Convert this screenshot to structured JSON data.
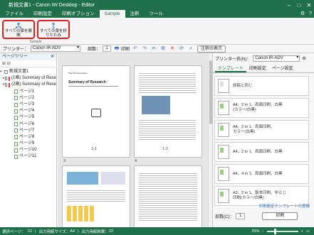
{
  "window": {
    "title": "新規文書1 - Canon iW Desktop - Editor"
  },
  "menu": {
    "items": [
      "ファイル",
      "印刷設定",
      "印刷オプション",
      "Sample",
      "注釈",
      "ツール"
    ],
    "active_index": 3
  },
  "ribbon": {
    "expand_all_label": "すべての章を展開",
    "collapse_all_label": "すべての章を折りたたみ",
    "group_label": "Sample"
  },
  "toolbar": {
    "printer_label": "プリンター：",
    "printer_value": "Canon iR-ADV",
    "copies_label": "部数：",
    "copies_value": "1",
    "print_label": "印刷",
    "annotation_btn": "注釈の表示"
  },
  "page_tree": {
    "header": "ページツリー",
    "root": "新規文書1",
    "chapters": [
      "(1章) Summary of Rese",
      "(2章) Summary of Rese"
    ],
    "pages": [
      "ページ1",
      "ページ2",
      "ページ3",
      "ページ4",
      "ページ5",
      "ページ6",
      "ページ7",
      "ページ8",
      "ページ9",
      "ページ10",
      "ページ11"
    ]
  },
  "thumbnails": {
    "labels": [
      "1-1",
      "1-2",
      "3",
      "4"
    ],
    "p1_title": "Summary of Research",
    "p1_company": "The XX Corporation"
  },
  "right_panel": {
    "printer_label": "プリンター名(N)：",
    "printer_value": "Canon iR-ADV",
    "tabs": [
      "テンプレート",
      "印刷設定",
      "ページ設定"
    ],
    "templates": [
      "原稿と同じ",
      "A4、2 in 1、両面印刷、白黒\n(カラー/白黒)",
      "A4、2 in 1、両面印刷、\nカラー(白黒)",
      "A4、2 in 1、両面印刷、白黒",
      "A4、4 in 1、両面印刷、白黒",
      "A3、2 in 1、製本印刷、中とじ\n印刷(カラー/白黒)"
    ],
    "save_template_link": "印刷設定テンプレートの登録",
    "copies_label": "部数(C)：",
    "copies_value": "1",
    "print_button": "印刷"
  },
  "status": {
    "selected": "選択ページ：",
    "selected_value": "22",
    "output_size_label": "出力用紙サイズ：",
    "output_size": "A4",
    "page_count_label": "出力用紙枚数：",
    "page_count": "22",
    "zoom": "25%"
  },
  "colors": {
    "accent": "#1e6f4a",
    "highlight": "#e02020"
  }
}
